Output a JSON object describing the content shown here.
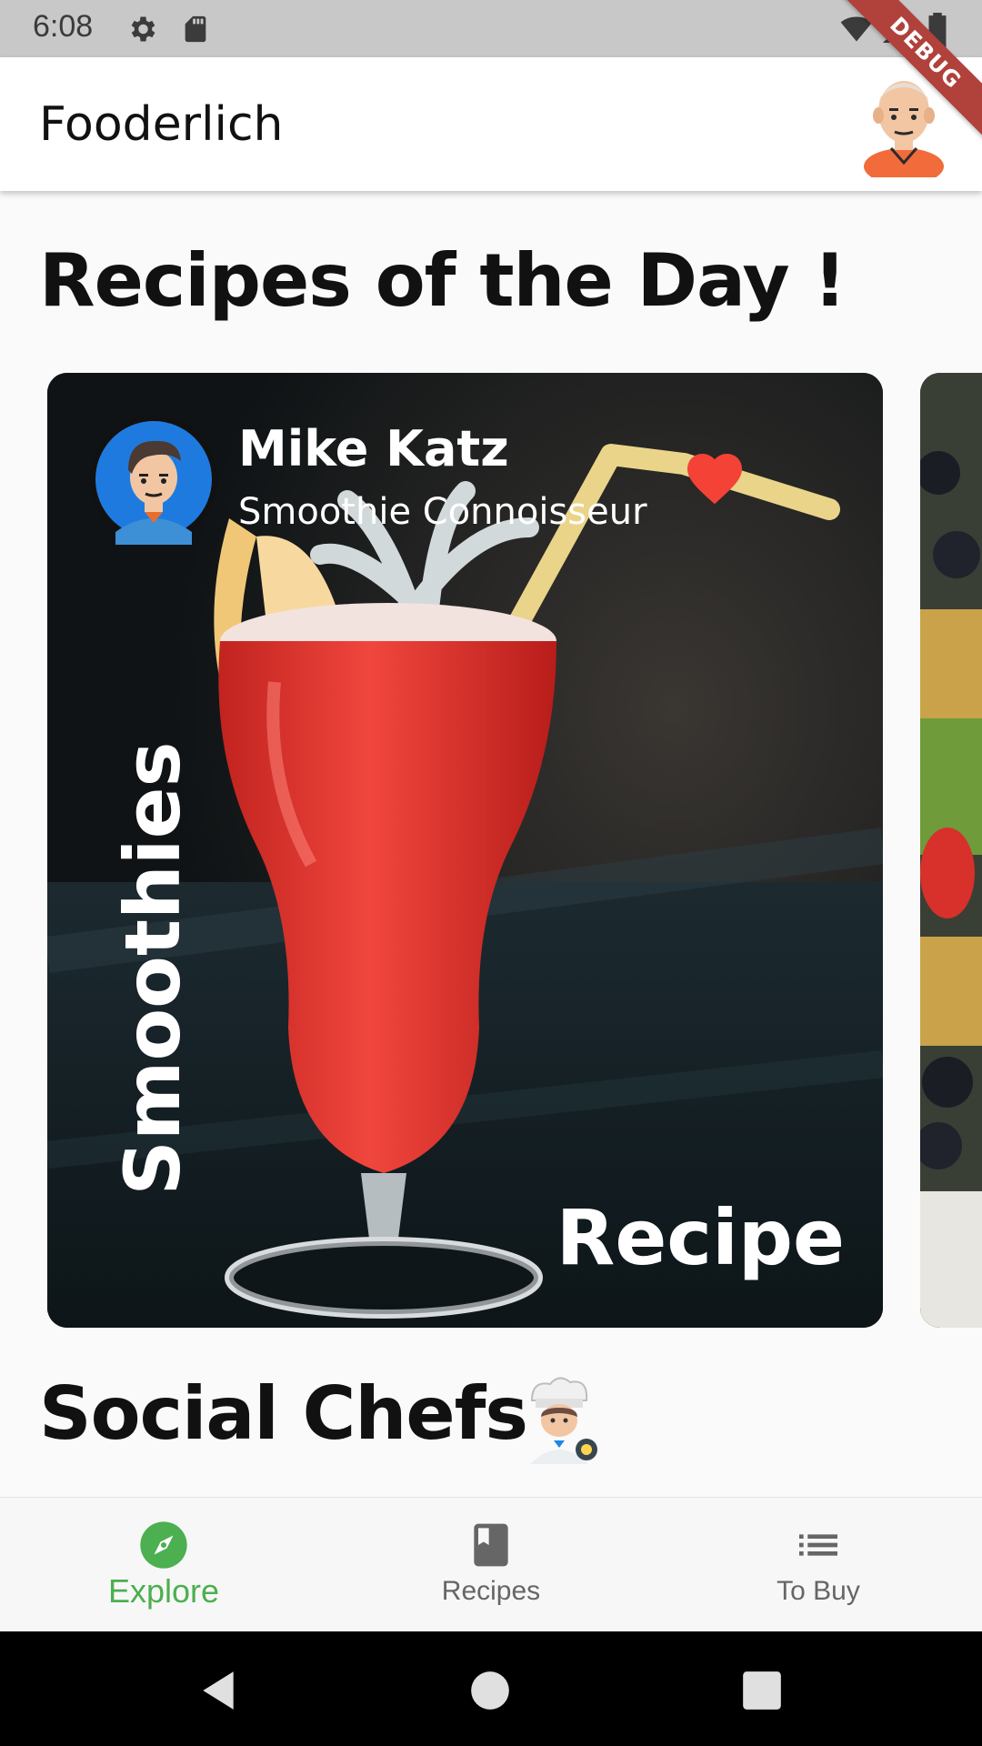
{
  "status_bar": {
    "time": "6:08"
  },
  "debug_banner": "DEBUG",
  "app_bar": {
    "title": "Fooderlich"
  },
  "sections": {
    "recipes_heading": "Recipes of the Day !",
    "social_heading": "Social Chefs"
  },
  "card": {
    "author_name": "Mike Katz",
    "author_title": "Smoothie Connoisseur",
    "category": "Smoothies",
    "label": "Recipe"
  },
  "bottom_nav": {
    "items": [
      {
        "label": "Explore",
        "icon": "compass-icon",
        "active": true
      },
      {
        "label": "Recipes",
        "icon": "book-icon",
        "active": false
      },
      {
        "label": "To Buy",
        "icon": "list-icon",
        "active": false
      }
    ]
  },
  "colors": {
    "accent": "#4caf50",
    "favorite": "#f44336",
    "debug": "#b0413b"
  }
}
